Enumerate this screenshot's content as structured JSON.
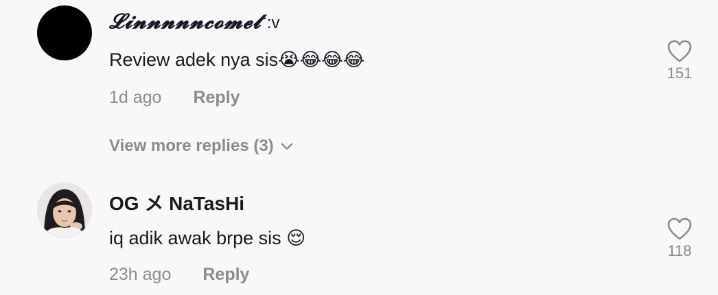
{
  "comments": [
    {
      "username": "𝓛𝓲𝓷𝓷𝓷𝓷𝓷𝓬𝓸𝓶𝓮𝓽",
      "username_suffix": ":v",
      "text": "Review adek nya sis😭😂😂😂",
      "time": "1d ago",
      "reply_label": "Reply",
      "likes": "151",
      "avatar": "black-circle"
    },
    {
      "username": "OG メ NaTasHi",
      "text": "iq adik awak brpe sis 😌",
      "time": "23h ago",
      "reply_label": "Reply",
      "likes": "118",
      "avatar": "profile-photo"
    }
  ],
  "view_more_replies": "View more replies (3)",
  "colors": {
    "background": "#f8f8f8",
    "primary_text": "#161823",
    "secondary_text": "#8a8b91"
  },
  "icons": [
    "heart-icon",
    "chevron-down-icon"
  ]
}
